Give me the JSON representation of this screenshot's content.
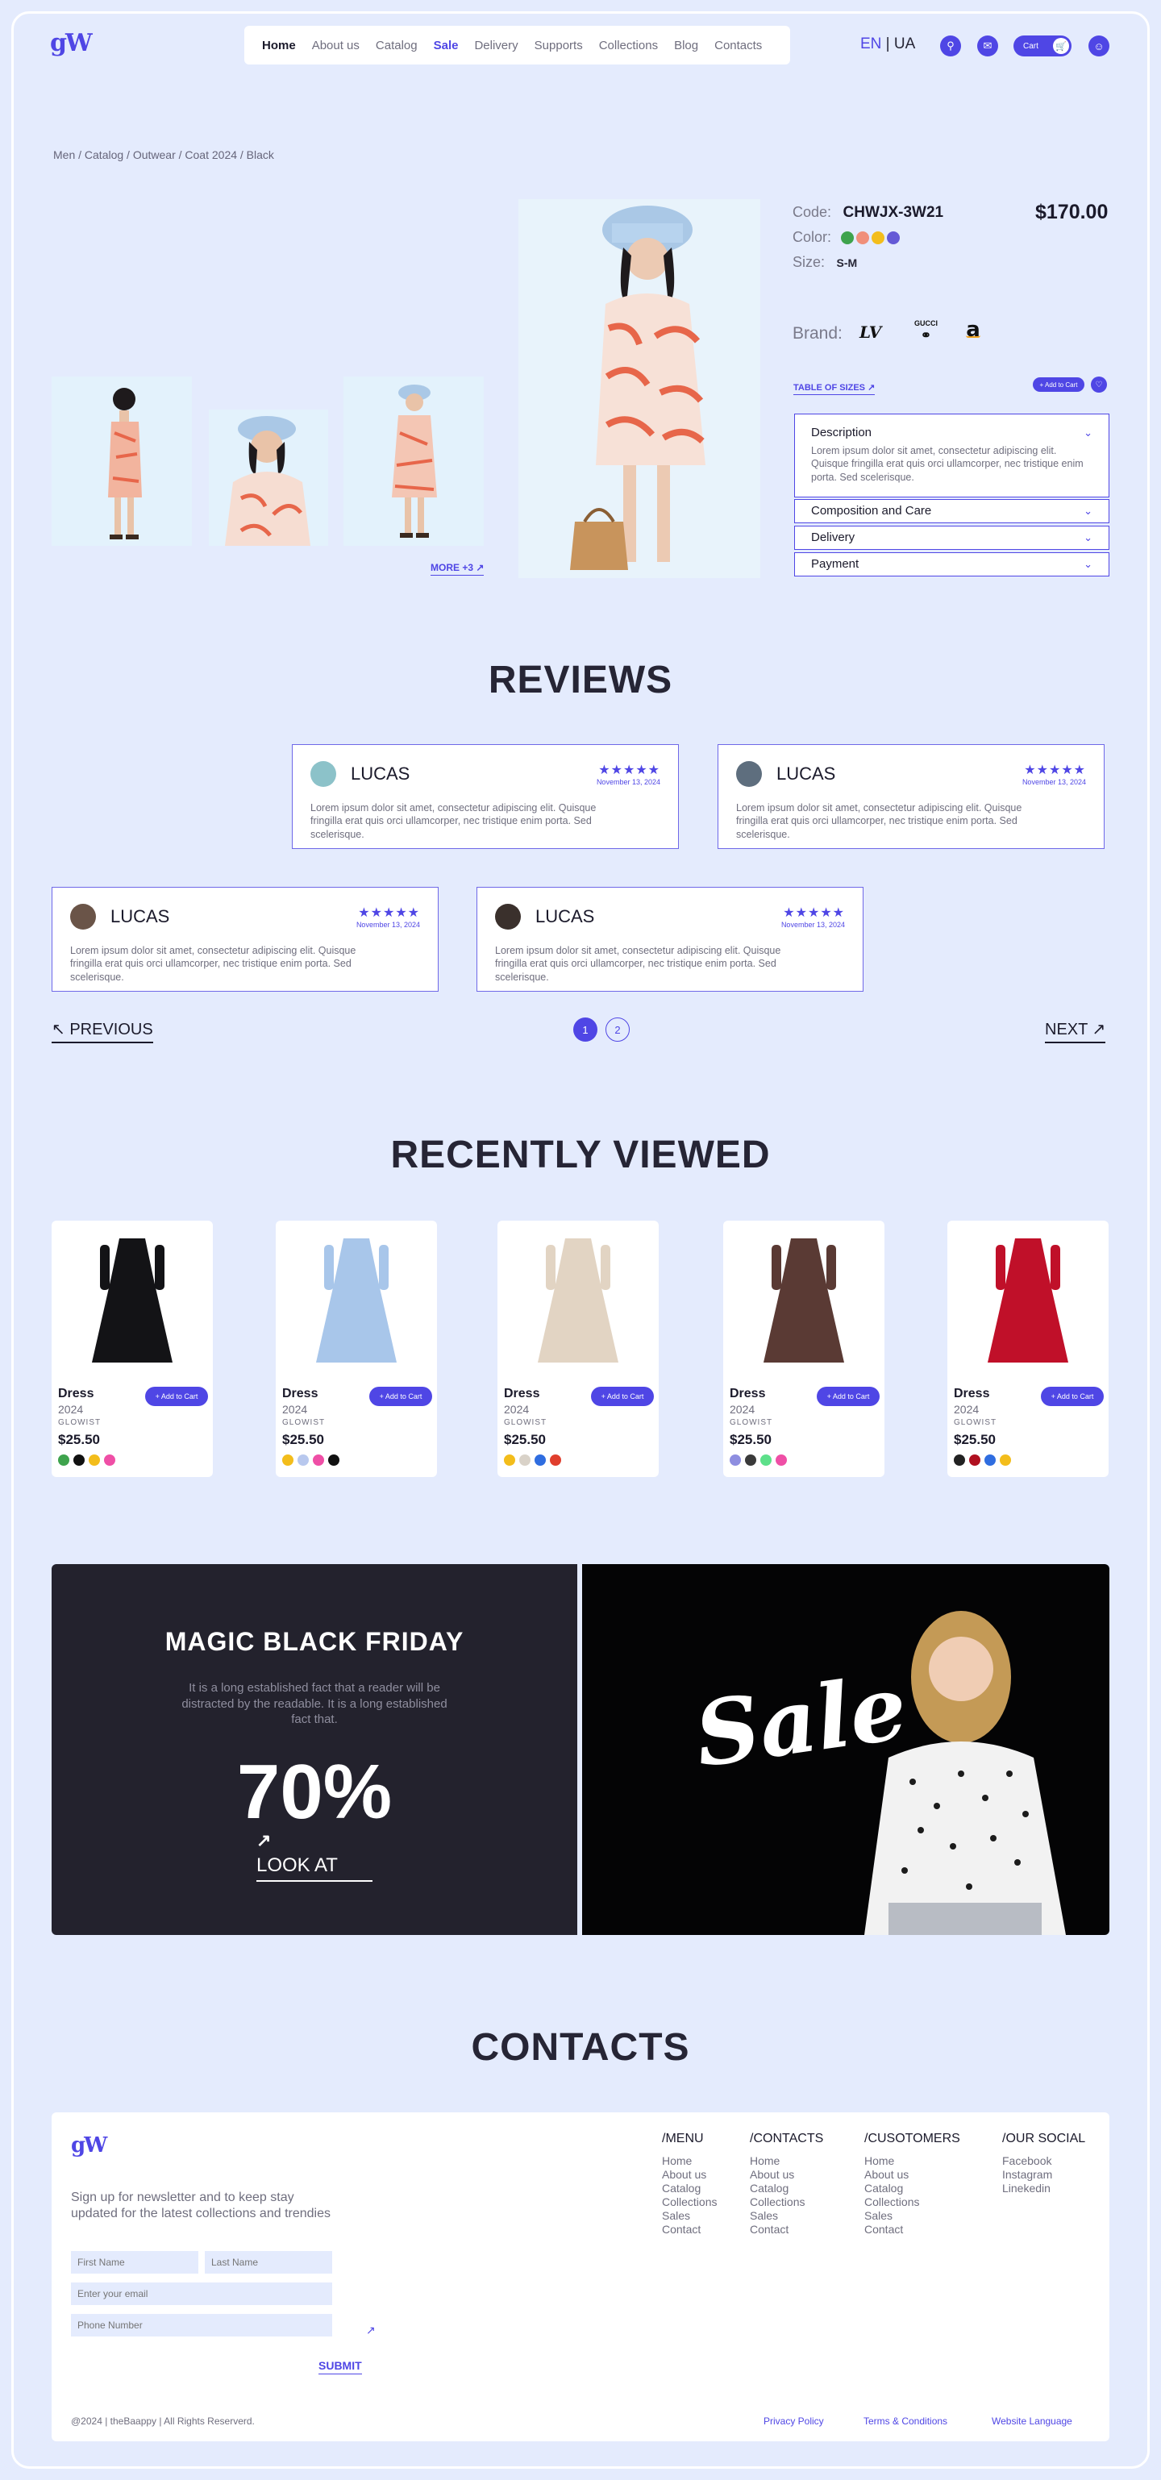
{
  "header": {
    "logo": "gW",
    "nav": [
      "Home",
      "About us",
      "Catalog",
      "Sale",
      "Delivery",
      "Supports",
      "Collections",
      "Blog",
      "Contacts"
    ],
    "lang_en": "EN",
    "lang_sep": " | ",
    "lang_ua": "UA",
    "cart_label": "Cart",
    "icons": [
      "search-icon",
      "chat-icon",
      "cart-icon",
      "user-icon"
    ]
  },
  "breadcrumb": "Men / Catalog / Outwear / Coat 2024 / Black",
  "product": {
    "code_label": "Code:",
    "code": "CHWJX-3W21",
    "color_label": "Color:",
    "colors": [
      "#3ea34d",
      "#f08f7a",
      "#f3bd1b",
      "#6459d6"
    ],
    "size_label": "Size:",
    "size": "S-M",
    "price": "$170.00",
    "brand_label": "Brand:",
    "brands": [
      "LV",
      "GUCCI",
      "a"
    ],
    "table_of_sizes": "TABLE OF SIZES",
    "add_to_cart": "+ Add to Cart",
    "more_photos": "MORE +3",
    "accordion": [
      {
        "title": "Description",
        "body": "Lorem ipsum dolor sit amet, consectetur adipiscing elit. Quisque fringilla erat quis orci ullamcorper, nec tristique enim porta. Sed scelerisque."
      },
      {
        "title": "Composition and Care"
      },
      {
        "title": "Delivery"
      },
      {
        "title": "Payment"
      }
    ]
  },
  "reviews": {
    "title": "REVIEWS",
    "items": [
      {
        "name": "LUCAS",
        "stars": "★★★★★",
        "date": "November 13, 2024",
        "text": "Lorem ipsum dolor sit amet, consectetur adipiscing elit. Quisque fringilla erat quis orci ullamcorper, nec tristique enim porta. Sed scelerisque."
      },
      {
        "name": "LUCAS",
        "stars": "★★★★★",
        "date": "November 13, 2024",
        "text": "Lorem ipsum dolor sit amet, consectetur adipiscing elit. Quisque fringilla erat quis orci ullamcorper, nec tristique enim porta. Sed scelerisque."
      },
      {
        "name": "LUCAS",
        "stars": "★★★★★",
        "date": "November 13, 2024",
        "text": "Lorem ipsum dolor sit amet, consectetur adipiscing elit. Quisque fringilla erat quis orci ullamcorper, nec tristique enim porta. Sed scelerisque."
      },
      {
        "name": "LUCAS",
        "stars": "★★★★★",
        "date": "November 13, 2024",
        "text": "Lorem ipsum dolor sit amet, consectetur adipiscing elit. Quisque fringilla erat quis orci ullamcorper, nec tristique enim porta. Sed scelerisque."
      }
    ],
    "previous": "PREVIOUS",
    "next": "NEXT",
    "pages": [
      "1",
      "2"
    ],
    "current_page": "1"
  },
  "recently_viewed": {
    "title": "RECENTLY VIEWED",
    "items": [
      {
        "name": "Dress",
        "year": "2024",
        "brand": "GLOWIST",
        "price": "$25.50",
        "add": "+ Add to Cart",
        "dress_color": "#131316",
        "colors": [
          "#3ea34d",
          "#111111",
          "#f3bd1b",
          "#ef4fa6"
        ]
      },
      {
        "name": "Dress",
        "year": "2024",
        "brand": "GLOWIST",
        "price": "$25.50",
        "add": "+ Add to Cart",
        "dress_color": "#a8c6ea",
        "colors": [
          "#f3bd1b",
          "#b8c8ee",
          "#ef4fa6",
          "#111111"
        ]
      },
      {
        "name": "Dress",
        "year": "2024",
        "brand": "GLOWIST",
        "price": "$25.50",
        "add": "+ Add to Cart",
        "dress_color": "#e2d4c3",
        "colors": [
          "#f3bd1b",
          "#d9d2c8",
          "#2f6de0",
          "#e03e2d"
        ]
      },
      {
        "name": "Dress",
        "year": "2024",
        "brand": "GLOWIST",
        "price": "$25.50",
        "add": "+ Add to Cart",
        "dress_color": "#5a3a34",
        "colors": [
          "#8e8ee0",
          "#3a3a3a",
          "#5de08a",
          "#ef4fa6"
        ]
      },
      {
        "name": "Dress",
        "year": "2024",
        "brand": "GLOWIST",
        "price": "$25.50",
        "add": "+ Add to Cart",
        "dress_color": "#c01029",
        "colors": [
          "#222222",
          "#b01020",
          "#2f6de0",
          "#f3bd1b"
        ]
      }
    ]
  },
  "banner": {
    "title": "MAGIC BLACK FRIDAY",
    "text": "It is a long established fact that a reader will be distracted by the readable. It is a long established fact that.",
    "discount": "70%",
    "cta": "LOOK AT",
    "sale_word": "Sale"
  },
  "contacts": {
    "title": "CONTACTS",
    "logo": "gW",
    "newsletter": "Sign up for newsletter and to keep stay updated for the latest collections and trendies",
    "first_name": "First Name",
    "last_name": "Last Name",
    "email": "Enter your email",
    "phone": "Phone Number",
    "submit": "SUBMIT",
    "columns": [
      {
        "title": "/MENU",
        "items": [
          "Home",
          "About us",
          "Catalog",
          "Collections",
          "Sales",
          "Contact"
        ]
      },
      {
        "title": "/CONTACTS",
        "items": [
          "Home",
          "About us",
          "Catalog",
          "Collections",
          "Sales",
          "Contact"
        ]
      },
      {
        "title": "/CUSOTOMERS",
        "items": [
          "Home",
          "About us",
          "Catalog",
          "Collections",
          "Sales",
          "Contact"
        ]
      },
      {
        "title": "/OUR SOCIAL",
        "items": [
          "Facebook",
          "Instagram",
          "Linekedin"
        ]
      }
    ],
    "copyright": "@2024 | theBaappy | All Rights Reserverd.",
    "privacy": "Privacy Policy",
    "terms": "Terms & Conditions",
    "website_language": "Website Language"
  }
}
